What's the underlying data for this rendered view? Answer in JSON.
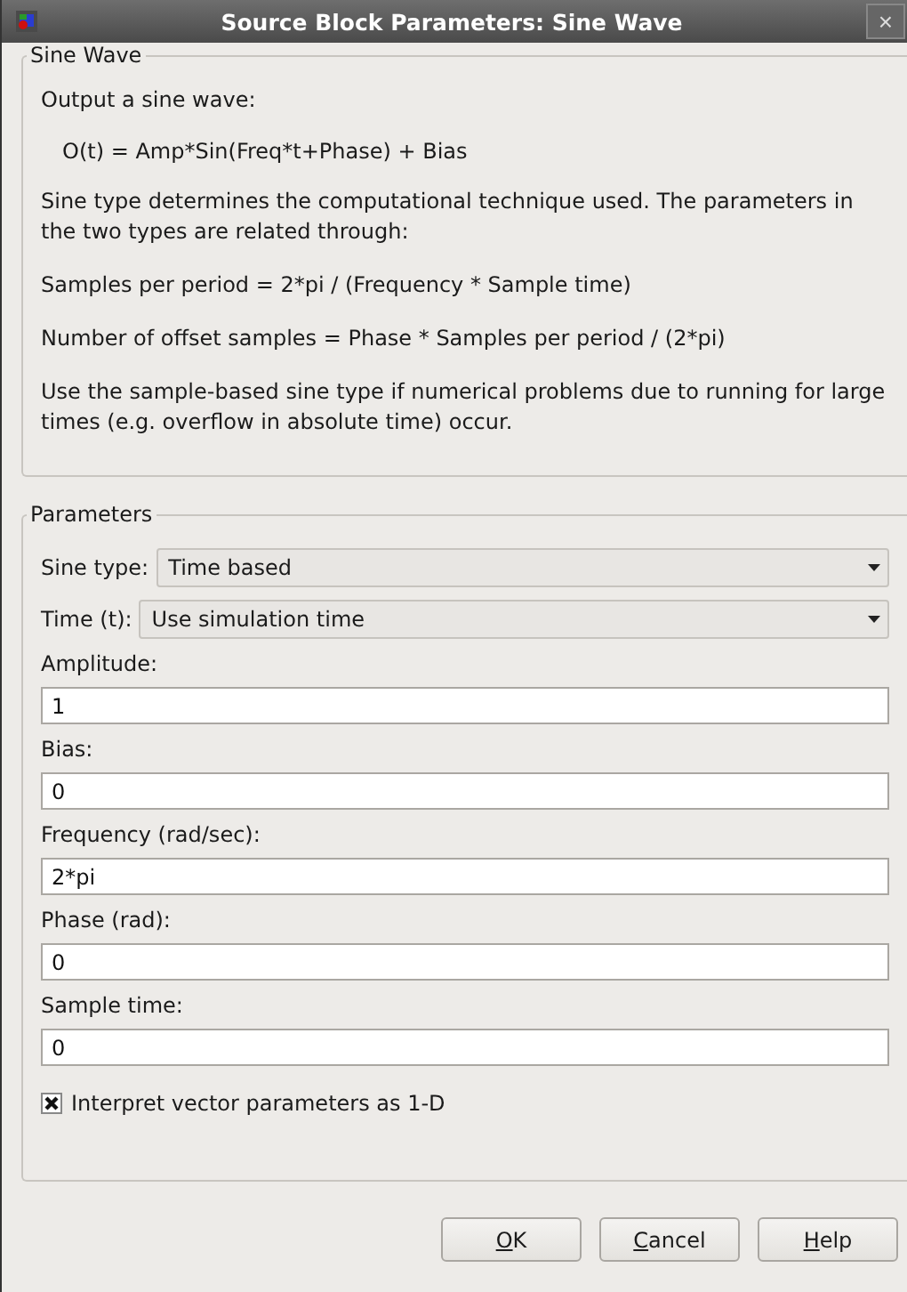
{
  "window": {
    "title": "Source Block Parameters: Sine Wave",
    "close": "×"
  },
  "description": {
    "legend": "Sine Wave",
    "paragraphs": [
      {
        "kind": "text",
        "text": "Output a sine wave:"
      },
      {
        "kind": "formula",
        "text": "O(t) = Amp*Sin(Freq*t+Phase) + Bias"
      },
      {
        "kind": "text",
        "text": "Sine type determines the computational technique used. The parameters in the two types are related through:"
      },
      {
        "kind": "text",
        "text": "Samples per period = 2*pi / (Frequency * Sample time)"
      },
      {
        "kind": "text",
        "text": "Number of offset samples = Phase * Samples per period / (2*pi)"
      },
      {
        "kind": "text",
        "text": "Use the sample-based sine type if numerical problems due to running for large times (e.g. overflow in absolute time) occur."
      }
    ]
  },
  "parameters": {
    "legend": "Parameters",
    "fields": [
      {
        "kind": "dropdown",
        "label": "Sine type:",
        "value": "Time based"
      },
      {
        "kind": "dropdown",
        "label": "Time (t):",
        "value": "Use simulation time"
      },
      {
        "kind": "text",
        "label": "Amplitude:",
        "value": "1"
      },
      {
        "kind": "text",
        "label": "Bias:",
        "value": "0"
      },
      {
        "kind": "text",
        "label": "Frequency (rad/sec):",
        "value": "2*pi"
      },
      {
        "kind": "text",
        "label": "Phase (rad):",
        "value": "0"
      },
      {
        "kind": "text",
        "label": "Sample time:",
        "value": "0"
      },
      {
        "kind": "checkbox",
        "label": "Interpret vector parameters as 1-D",
        "checked": true
      }
    ]
  },
  "buttons": [
    {
      "underlined": "O",
      "rest": "K"
    },
    {
      "underlined": "C",
      "rest": "ancel"
    },
    {
      "underlined": "H",
      "rest": "elp"
    }
  ]
}
